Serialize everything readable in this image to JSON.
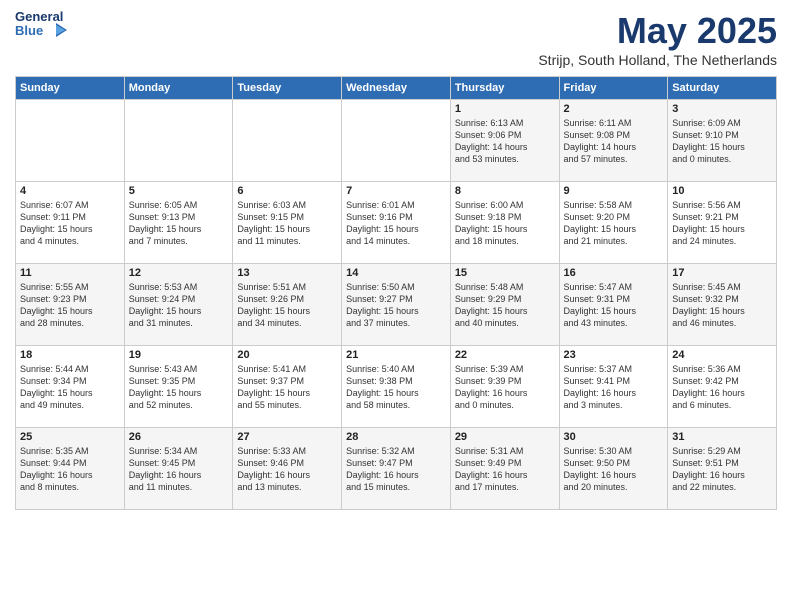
{
  "header": {
    "logo_general": "General",
    "logo_blue": "Blue",
    "month_title": "May 2025",
    "location": "Strijp, South Holland, The Netherlands"
  },
  "days_of_week": [
    "Sunday",
    "Monday",
    "Tuesday",
    "Wednesday",
    "Thursday",
    "Friday",
    "Saturday"
  ],
  "weeks": [
    [
      {
        "day": "",
        "info": ""
      },
      {
        "day": "",
        "info": ""
      },
      {
        "day": "",
        "info": ""
      },
      {
        "day": "",
        "info": ""
      },
      {
        "day": "1",
        "info": "Sunrise: 6:13 AM\nSunset: 9:06 PM\nDaylight: 14 hours\nand 53 minutes."
      },
      {
        "day": "2",
        "info": "Sunrise: 6:11 AM\nSunset: 9:08 PM\nDaylight: 14 hours\nand 57 minutes."
      },
      {
        "day": "3",
        "info": "Sunrise: 6:09 AM\nSunset: 9:10 PM\nDaylight: 15 hours\nand 0 minutes."
      }
    ],
    [
      {
        "day": "4",
        "info": "Sunrise: 6:07 AM\nSunset: 9:11 PM\nDaylight: 15 hours\nand 4 minutes."
      },
      {
        "day": "5",
        "info": "Sunrise: 6:05 AM\nSunset: 9:13 PM\nDaylight: 15 hours\nand 7 minutes."
      },
      {
        "day": "6",
        "info": "Sunrise: 6:03 AM\nSunset: 9:15 PM\nDaylight: 15 hours\nand 11 minutes."
      },
      {
        "day": "7",
        "info": "Sunrise: 6:01 AM\nSunset: 9:16 PM\nDaylight: 15 hours\nand 14 minutes."
      },
      {
        "day": "8",
        "info": "Sunrise: 6:00 AM\nSunset: 9:18 PM\nDaylight: 15 hours\nand 18 minutes."
      },
      {
        "day": "9",
        "info": "Sunrise: 5:58 AM\nSunset: 9:20 PM\nDaylight: 15 hours\nand 21 minutes."
      },
      {
        "day": "10",
        "info": "Sunrise: 5:56 AM\nSunset: 9:21 PM\nDaylight: 15 hours\nand 24 minutes."
      }
    ],
    [
      {
        "day": "11",
        "info": "Sunrise: 5:55 AM\nSunset: 9:23 PM\nDaylight: 15 hours\nand 28 minutes."
      },
      {
        "day": "12",
        "info": "Sunrise: 5:53 AM\nSunset: 9:24 PM\nDaylight: 15 hours\nand 31 minutes."
      },
      {
        "day": "13",
        "info": "Sunrise: 5:51 AM\nSunset: 9:26 PM\nDaylight: 15 hours\nand 34 minutes."
      },
      {
        "day": "14",
        "info": "Sunrise: 5:50 AM\nSunset: 9:27 PM\nDaylight: 15 hours\nand 37 minutes."
      },
      {
        "day": "15",
        "info": "Sunrise: 5:48 AM\nSunset: 9:29 PM\nDaylight: 15 hours\nand 40 minutes."
      },
      {
        "day": "16",
        "info": "Sunrise: 5:47 AM\nSunset: 9:31 PM\nDaylight: 15 hours\nand 43 minutes."
      },
      {
        "day": "17",
        "info": "Sunrise: 5:45 AM\nSunset: 9:32 PM\nDaylight: 15 hours\nand 46 minutes."
      }
    ],
    [
      {
        "day": "18",
        "info": "Sunrise: 5:44 AM\nSunset: 9:34 PM\nDaylight: 15 hours\nand 49 minutes."
      },
      {
        "day": "19",
        "info": "Sunrise: 5:43 AM\nSunset: 9:35 PM\nDaylight: 15 hours\nand 52 minutes."
      },
      {
        "day": "20",
        "info": "Sunrise: 5:41 AM\nSunset: 9:37 PM\nDaylight: 15 hours\nand 55 minutes."
      },
      {
        "day": "21",
        "info": "Sunrise: 5:40 AM\nSunset: 9:38 PM\nDaylight: 15 hours\nand 58 minutes."
      },
      {
        "day": "22",
        "info": "Sunrise: 5:39 AM\nSunset: 9:39 PM\nDaylight: 16 hours\nand 0 minutes."
      },
      {
        "day": "23",
        "info": "Sunrise: 5:37 AM\nSunset: 9:41 PM\nDaylight: 16 hours\nand 3 minutes."
      },
      {
        "day": "24",
        "info": "Sunrise: 5:36 AM\nSunset: 9:42 PM\nDaylight: 16 hours\nand 6 minutes."
      }
    ],
    [
      {
        "day": "25",
        "info": "Sunrise: 5:35 AM\nSunset: 9:44 PM\nDaylight: 16 hours\nand 8 minutes."
      },
      {
        "day": "26",
        "info": "Sunrise: 5:34 AM\nSunset: 9:45 PM\nDaylight: 16 hours\nand 11 minutes."
      },
      {
        "day": "27",
        "info": "Sunrise: 5:33 AM\nSunset: 9:46 PM\nDaylight: 16 hours\nand 13 minutes."
      },
      {
        "day": "28",
        "info": "Sunrise: 5:32 AM\nSunset: 9:47 PM\nDaylight: 16 hours\nand 15 minutes."
      },
      {
        "day": "29",
        "info": "Sunrise: 5:31 AM\nSunset: 9:49 PM\nDaylight: 16 hours\nand 17 minutes."
      },
      {
        "day": "30",
        "info": "Sunrise: 5:30 AM\nSunset: 9:50 PM\nDaylight: 16 hours\nand 20 minutes."
      },
      {
        "day": "31",
        "info": "Sunrise: 5:29 AM\nSunset: 9:51 PM\nDaylight: 16 hours\nand 22 minutes."
      }
    ]
  ]
}
